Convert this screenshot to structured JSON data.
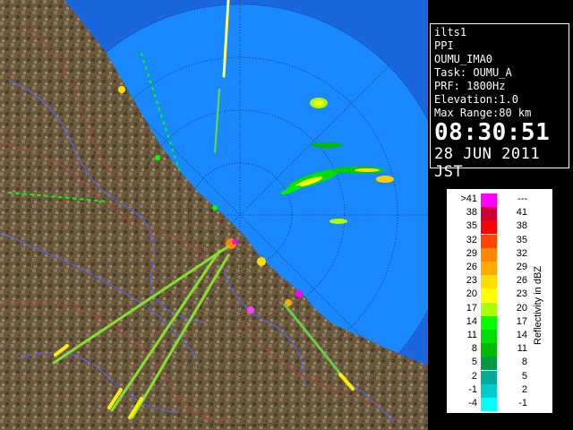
{
  "info": {
    "station": "ilts1",
    "product": "PPI",
    "site": "OUMU_IMA0",
    "task": "Task: OUMU_A",
    "prf": "PRF: 1800Hz",
    "elevation": "Elevation:1.0",
    "max_range": "Max Range:80 km",
    "time": "08:30:51",
    "date": "28 JUN 2011 JST"
  },
  "legend": {
    "title": "Reflectivity in dBZ",
    "rows": [
      {
        "left": ">41",
        "right": "---",
        "color": "#ff00ff"
      },
      {
        "left": "38",
        "right": "41",
        "color": "#cc0033"
      },
      {
        "left": "35",
        "right": "38",
        "color": "#ff0000"
      },
      {
        "left": "32",
        "right": "35",
        "color": "#ff4400"
      },
      {
        "left": "29",
        "right": "32",
        "color": "#ff8800"
      },
      {
        "left": "26",
        "right": "29",
        "color": "#ffaa00"
      },
      {
        "left": "23",
        "right": "26",
        "color": "#ffdd00"
      },
      {
        "left": "20",
        "right": "23",
        "color": "#ffff00"
      },
      {
        "left": "17",
        "right": "20",
        "color": "#aaff00"
      },
      {
        "left": "14",
        "right": "17",
        "color": "#00ff00"
      },
      {
        "left": "11",
        "right": "14",
        "color": "#00dd00"
      },
      {
        "left": "8",
        "right": "11",
        "color": "#00bb00"
      },
      {
        "left": "5",
        "right": "8",
        "color": "#009944"
      },
      {
        "left": "2",
        "right": "5",
        "color": "#00aa99"
      },
      {
        "left": "-1",
        "right": "2",
        "color": "#00cccc"
      },
      {
        "left": "-4",
        "right": "-1",
        "color": "#00ffff"
      }
    ]
  }
}
